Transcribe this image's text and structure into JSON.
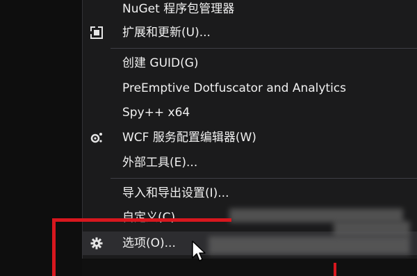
{
  "menu": {
    "items": [
      {
        "label": "NuGet 程序包管理器",
        "icon": ""
      },
      {
        "label": "扩展和更新(U)...",
        "icon": "extensions-icon"
      },
      {
        "label": "创建 GUID(G)",
        "icon": ""
      },
      {
        "label": "PreEmptive Dotfuscator and Analytics",
        "icon": ""
      },
      {
        "label": "Spy++ x64",
        "icon": ""
      },
      {
        "label": "WCF 服务配置编辑器(W)",
        "icon": "wcf-gear-icon"
      },
      {
        "label": "外部工具(E)...",
        "icon": ""
      },
      {
        "label": "导入和导出设置(I)...",
        "icon": ""
      },
      {
        "label": "自定义(C)...",
        "icon": ""
      },
      {
        "label": "选项(O)...",
        "icon": "gear-icon"
      }
    ]
  },
  "colors": {
    "menu_bg": "#1b1b1c",
    "hover_bg": "#2d2d30",
    "text": "#f1f1f1",
    "separator": "#3f3f46",
    "annotation_red": "#d8171e"
  }
}
